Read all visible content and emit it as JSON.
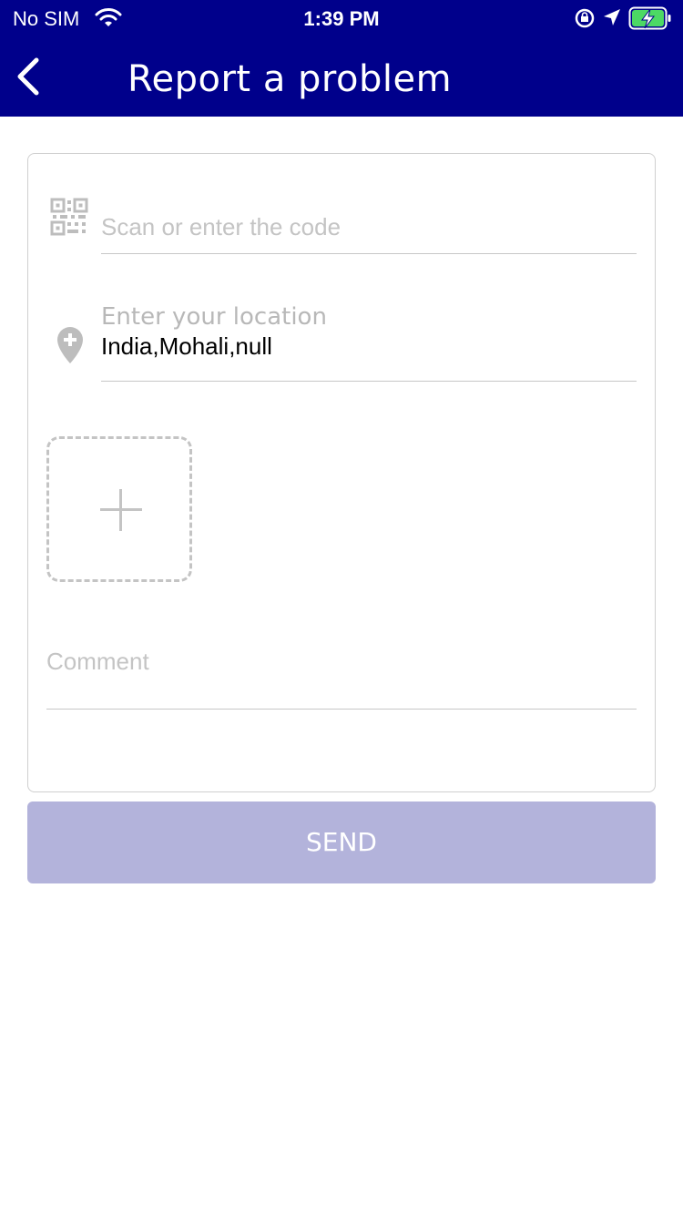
{
  "status_bar": {
    "carrier": "No SIM",
    "time": "1:39 PM"
  },
  "header": {
    "title": "Report a problem",
    "back_icon": "chevron-left-icon"
  },
  "form": {
    "code_placeholder": "Scan or enter the code",
    "code_icon": "qr-code-icon",
    "location_label": "Enter your location",
    "location_value": "India,Mohali,null",
    "location_icon": "location-pin-plus-icon",
    "add_photo_icon": "plus-icon",
    "comment_placeholder": "Comment"
  },
  "actions": {
    "send_label": "SEND"
  },
  "colors": {
    "header_bg": "#00008b",
    "send_bg": "#b3b3db",
    "battery_green": "#4cd964"
  }
}
